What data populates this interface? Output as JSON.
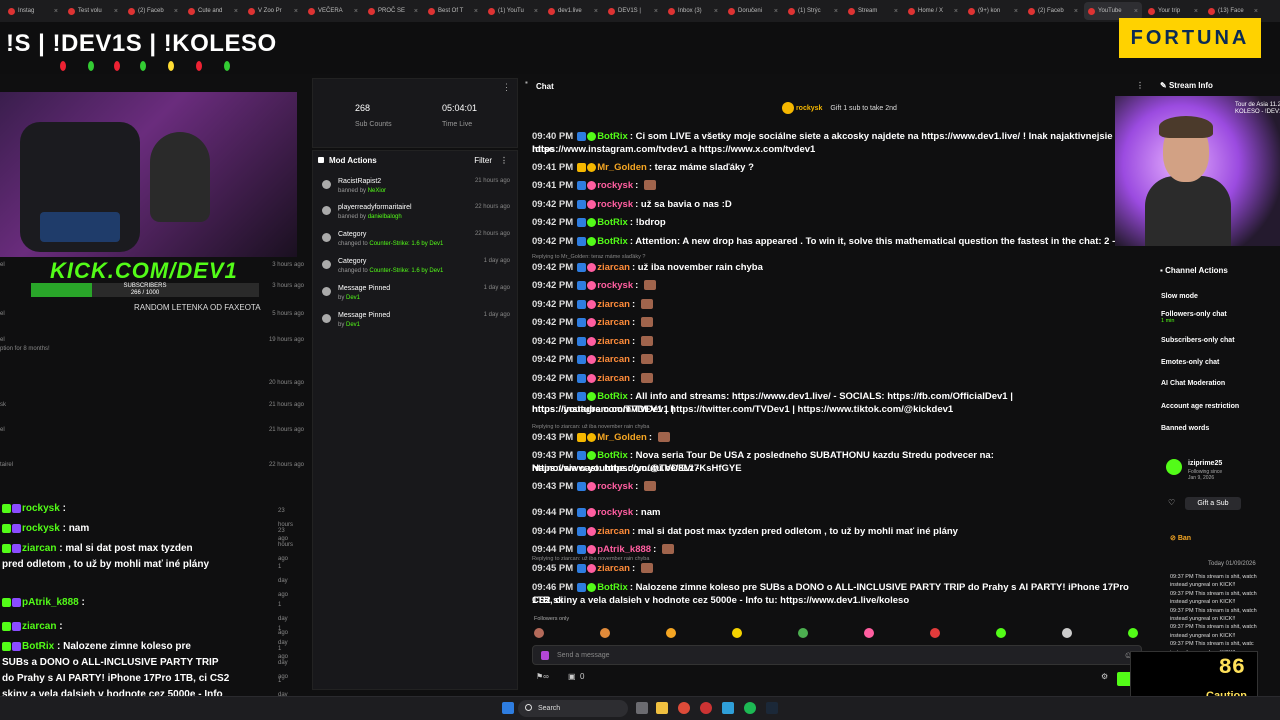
{
  "browser": {
    "tabs": [
      "Instag",
      "Test volu",
      "(2) Faceb",
      "Cute and",
      "V Zoo Pr",
      "VEČERA",
      "PROČ SE",
      "Best Of T",
      "(1) YouTu",
      "dev1.live",
      "DEV1S |",
      "Inbox (3)",
      "Doručeni",
      "(1) Strýc",
      "Stream",
      "Home / X",
      "(9+) kon",
      "(2) Faceb",
      "YouTube",
      "Your trip",
      "(13) Face"
    ]
  },
  "overlay": {
    "title": "!S | !DEV1S | !KOLESO",
    "kick": "KICK.COM/DEV1",
    "subs_label": "SUBSCRIBERS",
    "subs_count": "266 / 1000",
    "subs_progress": 0.266,
    "random": "RANDOM LETENKA OD FAXEOTA",
    "fortuna": "FORTUNA",
    "caution_value": "86",
    "caution_label": "Caution"
  },
  "bg_list": [
    {
      "text": "el",
      "time": "3 hours ago"
    },
    {
      "text": "",
      "time": "3 hours ago"
    },
    {
      "text": "el",
      "time": "5 hours ago"
    },
    {
      "text": "el",
      "time": "19 hours ago"
    },
    {
      "text": "ption for 8 months!",
      "time": ""
    },
    {
      "text": "",
      "time": "20 hours ago"
    },
    {
      "text": "sk",
      "time": "21 hours ago"
    },
    {
      "text": "el",
      "time": "21 hours ago"
    },
    {
      "text": "tairel",
      "time": "22 hours ago"
    }
  ],
  "left_chat": [
    {
      "user": "rockysk",
      "text": "",
      "time": "23 hours ago"
    },
    {
      "user": "rockysk",
      "text": "nam",
      "time": "23 hours ago"
    },
    {
      "user": "ziarcan",
      "text": "mal si dat post max tyzden",
      "time": ""
    },
    {
      "user": "",
      "text": "pred odletom , to už by mohli mať iné plány",
      "time": "1 day ago"
    },
    {
      "user": "pAtrik_k888",
      "text": "",
      "time": "1 day ago"
    },
    {
      "user": "ziarcan",
      "text": "",
      "time": "1 day ago"
    },
    {
      "user": "BotRix",
      "text": "Nalozene zimne koleso pre",
      "time": "1 day ago"
    },
    {
      "user": "",
      "text": "SUBs a DONO o ALL-INCLUSIVE PARTY TRIP",
      "time": ""
    },
    {
      "user": "",
      "text": "do Prahy s AI PARTY! iPhone 17Pro 1TB, ci CS2",
      "time": "1 day ago"
    },
    {
      "user": "",
      "text": "skiny a vela dalsieh v hodnote cez 5000e - Info",
      "time": ""
    },
    {
      "user": "",
      "text": "tu: https://www.dev1.live/koleso",
      "time": ""
    }
  ],
  "dashboard": {
    "sub_counts": "268",
    "sub_counts_label": "Sub Counts",
    "time_live": "05:04:01",
    "time_live_label": "Time Live",
    "mod_actions_title": "Mod Actions",
    "filter_label": "Filter",
    "mod_actions": [
      {
        "name": "RacistRapist2",
        "sub_prefix": "banned by ",
        "sub_by": "NeXior",
        "time": "21 hours ago"
      },
      {
        "name": "playerreadyformaritairel",
        "sub_prefix": "banned by ",
        "sub_by": "danielbalogh",
        "time": "22 hours ago"
      },
      {
        "name": "Category",
        "sub_prefix": "changed to ",
        "sub_by": "Counter-Strike: 1.6 by Dev1",
        "time": "22 hours ago"
      },
      {
        "name": "Category",
        "sub_prefix": "changed to ",
        "sub_by": "Counter-Strike: 1.6 by Dev1",
        "time": "1 day ago"
      },
      {
        "name": "Message Pinned",
        "sub_prefix": "by ",
        "sub_by": "Dev1",
        "time": "1 day ago"
      },
      {
        "name": "Message Pinned",
        "sub_prefix": "by ",
        "sub_by": "Dev1",
        "time": "1 day ago"
      }
    ]
  },
  "chat": {
    "title": "Chat",
    "pinned_user": "rockysk",
    "pinned_text": "Gift 1 sub to take 2nd",
    "messages": [
      {
        "ts": "09:40 PM",
        "user": "BotRix",
        "color": "#53fc18",
        "text": "Ci som LIVE a všetky moje sociálne siete a akcosky najdete na https://www.dev1.live/ ! Inak najaktivnejsie na !disc"
      },
      {
        "ts": "",
        "user": "",
        "color": "#fff",
        "text": "https://www.instagram.com/tvdev1 a https://www.x.com/tvdev1"
      },
      {
        "ts": "09:41 PM",
        "user": "Mr_Golden",
        "color": "#f5a623",
        "text": "teraz máme slaďáky ?"
      },
      {
        "ts": "09:41 PM",
        "user": "rockysk",
        "color": "#ff5ea0",
        "text": ""
      },
      {
        "ts": "09:42 PM",
        "user": "rockysk",
        "color": "#ff5ea0",
        "text": "už sa bavia o nas :D"
      },
      {
        "ts": "09:42 PM",
        "user": "BotRix",
        "color": "#53fc18",
        "text": "!bdrop"
      },
      {
        "ts": "09:42 PM",
        "user": "BotRix",
        "color": "#53fc18",
        "text": "Attention: A new drop has appeared . To win it, solve this mathematical question the fastest in the chat: 2 - 6 = ?"
      },
      {
        "ts": "09:42 PM",
        "user": "ziarcan",
        "color": "#ff8c3a",
        "text": "už iba november rain chyba"
      },
      {
        "ts": "09:42 PM",
        "user": "rockysk",
        "color": "#ff5ea0",
        "text": ""
      },
      {
        "ts": "09:42 PM",
        "user": "ziarcan",
        "color": "#ff8c3a",
        "text": ""
      },
      {
        "ts": "09:42 PM",
        "user": "ziarcan",
        "color": "#ff8c3a",
        "text": ""
      },
      {
        "ts": "09:42 PM",
        "user": "ziarcan",
        "color": "#ff8c3a",
        "text": ""
      },
      {
        "ts": "09:42 PM",
        "user": "ziarcan",
        "color": "#ff8c3a",
        "text": ""
      },
      {
        "ts": "09:42 PM",
        "user": "ziarcan",
        "color": "#ff8c3a",
        "text": ""
      },
      {
        "ts": "09:43 PM",
        "user": "BotRix",
        "color": "#53fc18",
        "text": "All info and streams: https://www.dev1.live/ - SOCIALS: https://fb.com/OfficialDev1 | https://instagram.com/TVDev1 |"
      },
      {
        "ts": "",
        "user": "",
        "color": "#fff",
        "text": "https://youtube.com/TVDEV1 | https://twitter.com/TVDev1 | https://www.tiktok.com/@kickdev1"
      },
      {
        "ts": "09:43 PM",
        "user": "Mr_Golden",
        "color": "#f5a623",
        "text": ""
      },
      {
        "ts": "09:43 PM",
        "user": "BotRix",
        "color": "#53fc18",
        "text": "Nova seria Tour De USA z posledneho SUBATHONU kazdu Stredu podvecer na: https://www.youtube.com/@TVDEVI -"
      },
      {
        "ts": "",
        "user": "",
        "color": "#fff",
        "text": "Najnovsia cast: https://youtu.be/8Lz7KsHfGYE"
      },
      {
        "ts": "09:43 PM",
        "user": "rockysk",
        "color": "#ff5ea0",
        "text": ""
      },
      {
        "ts": "09:44 PM",
        "user": "rockysk",
        "color": "#ff5ea0",
        "text": "nam"
      },
      {
        "ts": "09:44 PM",
        "user": "ziarcan",
        "color": "#ff8c3a",
        "text": "mal si dat post max tyzden pred odletom , to už by mohli mať iné plány"
      },
      {
        "ts": "09:44 PM",
        "user": "pAtrik_k888",
        "color": "#ff5ea0",
        "text": ""
      },
      {
        "ts": "09:45 PM",
        "user": "ziarcan",
        "color": "#ff8c3a",
        "text": ""
      },
      {
        "ts": "09:46 PM",
        "user": "BotRix",
        "color": "#53fc18",
        "text": "Nalozene zimne koleso pre SUBs a DONO o ALL-INCLUSIVE PARTY TRIP do Prahy s AI PARTY! iPhone 17Pro 1TB, ci"
      },
      {
        "ts": "",
        "user": "",
        "color": "#fff",
        "text": "CS2 skiny a vela dalsieh v hodnote cez 5000e - Info tu: https://www.dev1.live/koleso"
      }
    ],
    "replies": [
      "Replying to Mr_Golden: teraz máme slaďáky ?",
      "Replying to ziarcan: už iba november rain chyba",
      "Replying to ziarcan: už iba november rain chyba"
    ],
    "followers_label": "Followers only",
    "input_placeholder": "Send a message",
    "footer_count": "0"
  },
  "right": {
    "stream_info": "Stream Info",
    "cam_overlay": "Tour de Asia 11.2 a IEM\nKOLESO - !DEV1S !S",
    "channel_actions": "Channel Actions",
    "actions": [
      {
        "label": "Slow mode",
        "sub": ""
      },
      {
        "label": "Followers-only chat",
        "sub": "1 min"
      },
      {
        "label": "Subscribers-only chat",
        "sub": ""
      },
      {
        "label": "Emotes-only chat",
        "sub": ""
      },
      {
        "label": "AI Chat Moderation",
        "sub": ""
      },
      {
        "label": "Account age restriction",
        "sub": ""
      },
      {
        "label": "Banned words",
        "sub": ""
      }
    ],
    "user_name": "iziprime25",
    "user_follow": "Following since",
    "user_date": "Jan 9, 2026",
    "gift_sub": "Gift a Sub",
    "ban": "Ban",
    "ban_date": "Today 01/09/2026",
    "ban_msgs": [
      "09:37 PM This stream is shit, watch",
      "instead yungreal on KICK!!",
      "09:37 PM This stream is shit, watch",
      "instead yungreal on KICK!!",
      "09:37 PM This stream is shit, watch",
      "instead yungreal on KICK!!",
      "09:37 PM This stream is shit, watch",
      "instead yungreal on KICK!!",
      "09:37 PM This stream is shit, watc",
      "instead yungreal on KICK!!"
    ]
  },
  "taskbar": {
    "search": "Search"
  }
}
